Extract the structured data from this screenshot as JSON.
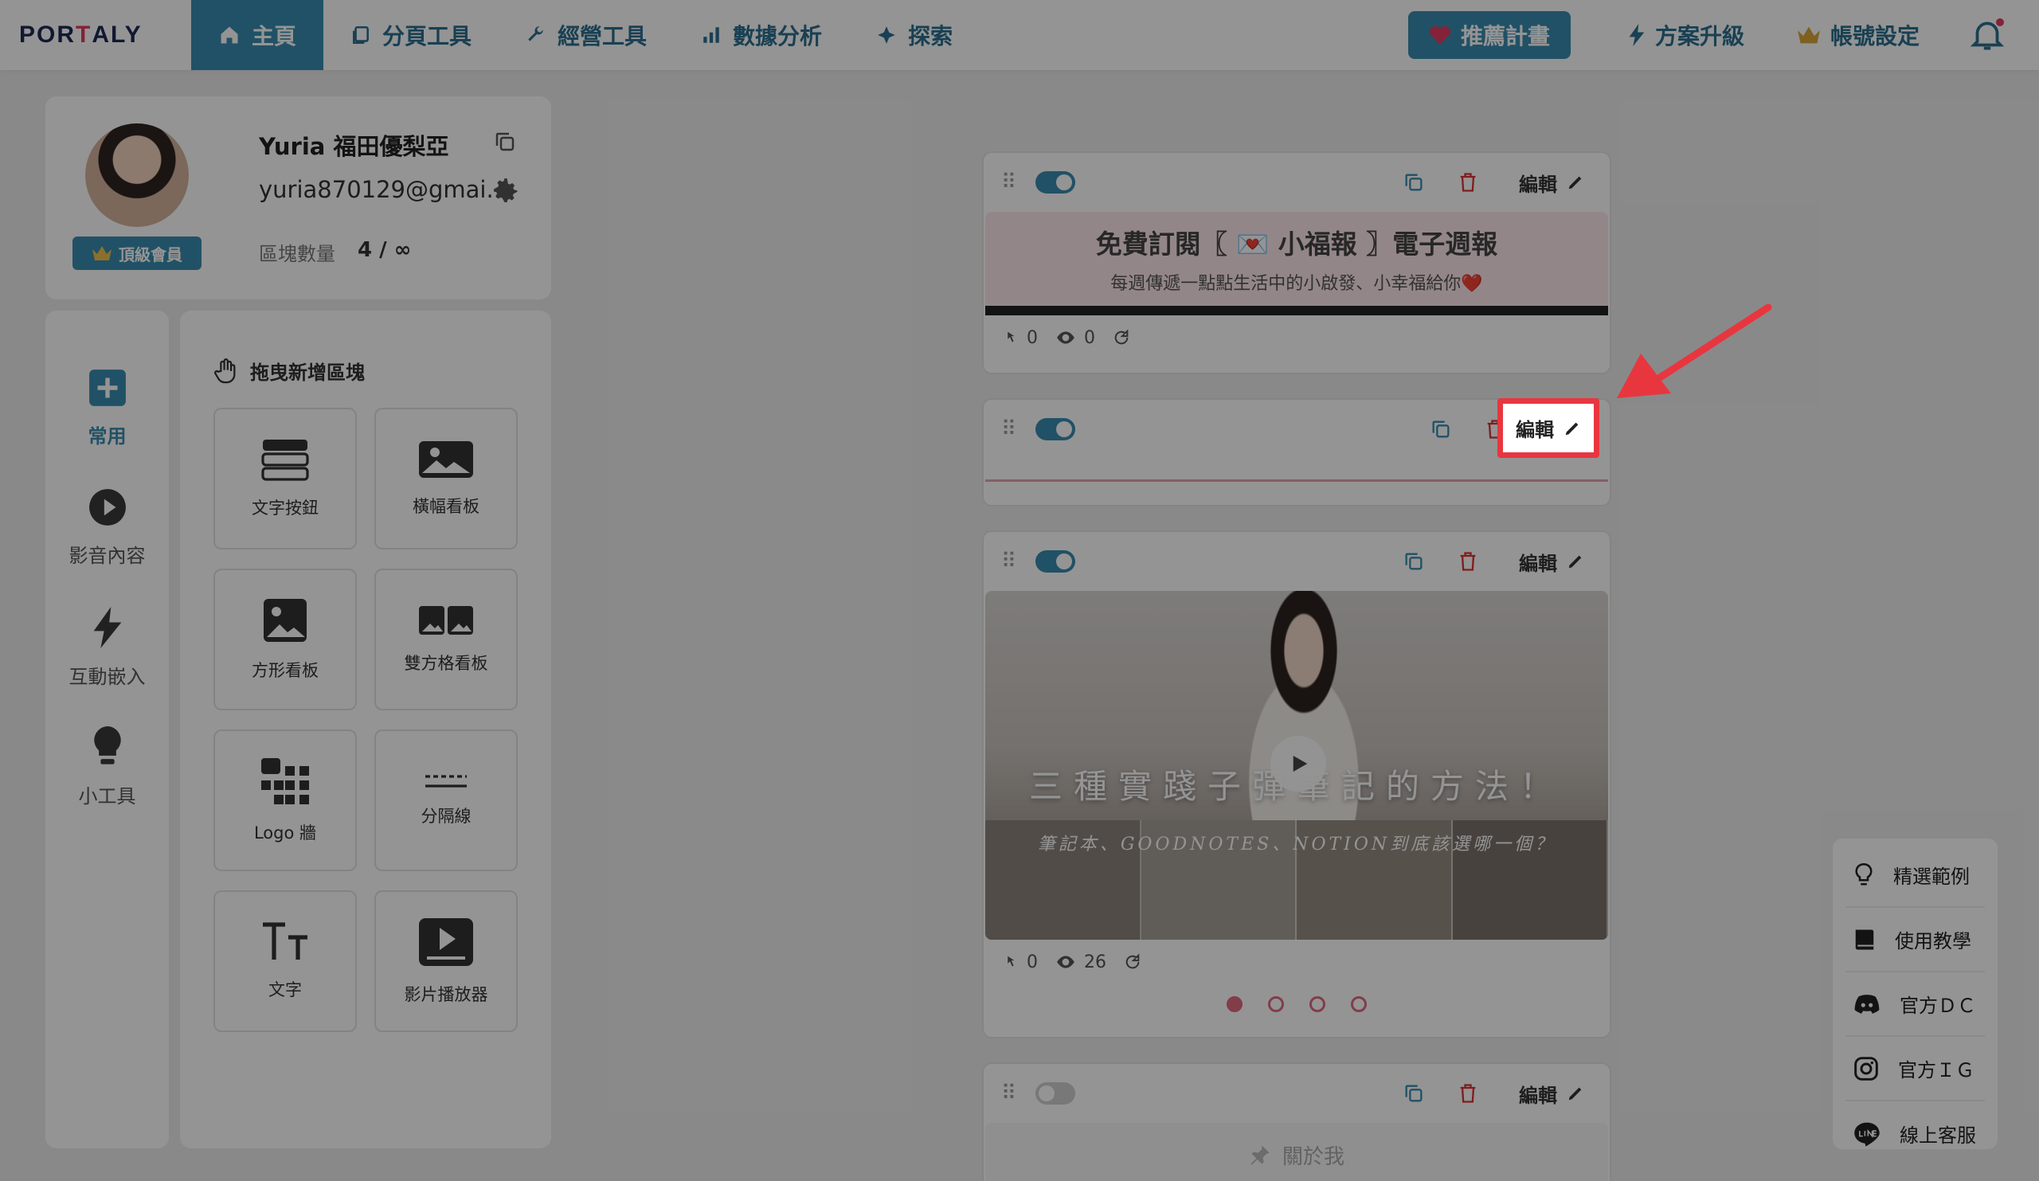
{
  "nav": {
    "logo_part1": "POR",
    "logo_part2": "T",
    "logo_part3": "ALY",
    "items": [
      {
        "label": "主頁",
        "icon": "home-icon",
        "active": true
      },
      {
        "label": "分頁工具",
        "icon": "pages-icon"
      },
      {
        "label": "經營工具",
        "icon": "wrench-icon"
      },
      {
        "label": "數據分析",
        "icon": "bar-chart-icon"
      },
      {
        "label": "探索",
        "icon": "compass-icon"
      }
    ],
    "referral": "推薦計畫",
    "upgrade": "方案升級",
    "account": "帳號設定"
  },
  "profile": {
    "name": "Yuria 福田優梨亞",
    "email": "yuria870129@gmai...",
    "badge": "頂級會員",
    "count_label": "區塊數量",
    "count_value": "4 / ∞"
  },
  "categories": [
    {
      "label": "常用",
      "icon": "plus-square-icon",
      "active": true
    },
    {
      "label": "影音內容",
      "icon": "play-circle-icon"
    },
    {
      "label": "互動嵌入",
      "icon": "lightning-icon"
    },
    {
      "label": "小工具",
      "icon": "lightbulb-icon"
    }
  ],
  "blocks_panel": {
    "title": "拖曳新增區塊",
    "tiles": [
      {
        "label": "文字按鈕",
        "icon": "text-button-icon"
      },
      {
        "label": "橫幅看板",
        "icon": "banner-image-icon"
      },
      {
        "label": "方形看板",
        "icon": "square-image-icon"
      },
      {
        "label": "雙方格看板",
        "icon": "double-image-icon"
      },
      {
        "label": "Logo 牆",
        "icon": "logo-grid-icon"
      },
      {
        "label": "分隔線",
        "icon": "divider-icon"
      },
      {
        "label": "文字",
        "icon": "text-icon"
      },
      {
        "label": "影片播放器",
        "icon": "video-player-icon"
      }
    ]
  },
  "preview": {
    "edit_label": "編輯",
    "block1": {
      "title": "免費訂閱〖 💌 小福報 〗電子週報",
      "subtitle": "每週傳遞一點點生活中的小啟發、小幸福給你❤️",
      "clicks": "0",
      "views": "0"
    },
    "block3": {
      "video_title": "三種實踐子彈筆記的方法！",
      "video_subtitle": "筆記本、GOODNOTES、NOTION到底該選哪一個？",
      "clicks": "0",
      "views": "26"
    },
    "block4": {
      "title": "關於我"
    }
  },
  "help": [
    {
      "label": "精選範例",
      "icon": "lightbulb-icon"
    },
    {
      "label": "使用教學",
      "icon": "book-icon"
    },
    {
      "label": "官方ＤＣ",
      "icon": "discord-icon"
    },
    {
      "label": "官方ＩＧ",
      "icon": "instagram-icon"
    },
    {
      "label": "線上客服",
      "icon": "line-icon"
    }
  ],
  "colors": {
    "accent": "#3a8cb0",
    "highlight": "#e8363f"
  }
}
